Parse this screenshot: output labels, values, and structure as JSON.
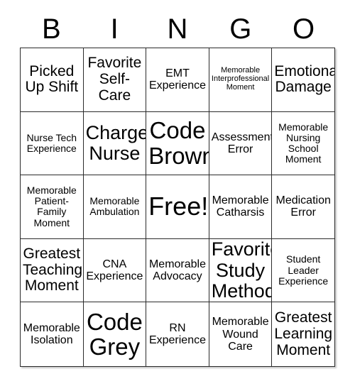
{
  "card": {
    "headers": [
      "B",
      "I",
      "N",
      "G",
      "O"
    ],
    "rows": [
      [
        {
          "text": "Picked Up Shift",
          "size": "lg"
        },
        {
          "text": "Favorite Self-Care",
          "size": "lg"
        },
        {
          "text": "EMT Experience",
          "size": "md"
        },
        {
          "text": "Memorable Interprofessional Moment",
          "size": "xs"
        },
        {
          "text": "Emotional Damage",
          "size": "lg"
        }
      ],
      [
        {
          "text": "Nurse Tech Experience",
          "size": "sm"
        },
        {
          "text": "Charge Nurse",
          "size": "xl"
        },
        {
          "text": "Code Brown",
          "size": "xxl"
        },
        {
          "text": "Assessment Error",
          "size": "md"
        },
        {
          "text": "Memorable Nursing School Moment",
          "size": "sm"
        }
      ],
      [
        {
          "text": "Memorable Patient-Family Moment",
          "size": "sm"
        },
        {
          "text": "Memorable Ambulation",
          "size": "sm"
        },
        {
          "text": "Free!",
          "size": "free"
        },
        {
          "text": "Memorable Catharsis",
          "size": "md"
        },
        {
          "text": "Medication Error",
          "size": "md"
        }
      ],
      [
        {
          "text": "Greatest Teaching Moment",
          "size": "lg"
        },
        {
          "text": "CNA Experience",
          "size": "md"
        },
        {
          "text": "Memorable Advocacy",
          "size": "md"
        },
        {
          "text": "Favorite Study Method",
          "size": "xl"
        },
        {
          "text": "Student Leader Experience",
          "size": "sm"
        }
      ],
      [
        {
          "text": "Memorable Isolation",
          "size": "md"
        },
        {
          "text": "Code Grey",
          "size": "xxl"
        },
        {
          "text": "RN Experience",
          "size": "md"
        },
        {
          "text": "Memorable Wound Care",
          "size": "md"
        },
        {
          "text": "Greatest Learning Moment",
          "size": "lg"
        }
      ]
    ]
  },
  "colors": {
    "background": "#ffffff",
    "grid_line": "#2b2b2b",
    "text": "#000000"
  }
}
